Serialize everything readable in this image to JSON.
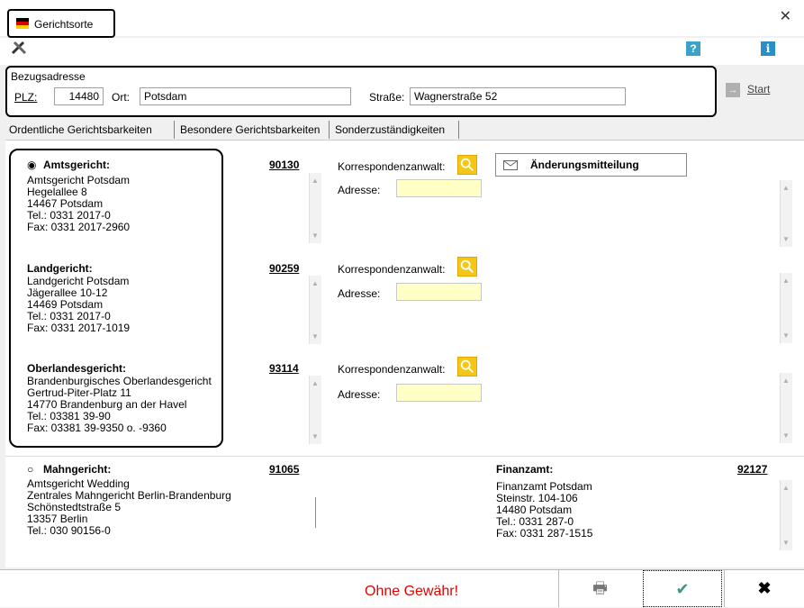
{
  "window": {
    "title": "Gerichtsorte"
  },
  "address": {
    "section_label": "Bezugsadresse",
    "plz_label": "PLZ:",
    "plz_value": "14480",
    "ort_label": "Ort:",
    "ort_value": "Potsdam",
    "strasse_label": "Straße:",
    "strasse_value": "Wagnerstraße 52",
    "start_label": "Start"
  },
  "tabs": [
    {
      "label": "Ordentliche Gerichtsbarkeiten"
    },
    {
      "label": "Besondere Gerichtsbarkeiten"
    },
    {
      "label": "Sonderzuständigkeiten"
    }
  ],
  "courts": {
    "amtsgericht": {
      "title": "Amtsgericht:",
      "code": "90130",
      "lines": [
        "Amtsgericht Potsdam",
        "Hegelallee 8",
        "14467 Potsdam",
        "Tel.: 0331 2017-0",
        "Fax: 0331 2017-2960"
      ]
    },
    "landgericht": {
      "title": "Landgericht:",
      "code": "90259",
      "lines": [
        "Landgericht Potsdam",
        "Jägerallee 10-12",
        "14469 Potsdam",
        "Tel.: 0331 2017-0",
        "Fax: 0331 2017-1019"
      ]
    },
    "oberlandesgericht": {
      "title": "Oberlandesgericht:",
      "code": "93114",
      "lines": [
        "Brandenburgisches Oberlandesgericht",
        "Gertrud-Piter-Platz 11",
        "14770 Brandenburg an der Havel",
        "Tel.: 03381 39-90",
        "Fax: 03381 39-9350 o. -9360"
      ]
    },
    "mahngericht": {
      "title": "Mahngericht:",
      "code": "91065",
      "lines": [
        "Amtsgericht Wedding",
        "Zentrales Mahngericht Berlin-Brandenburg",
        "Schönstedtstraße 5",
        "13357 Berlin",
        "Tel.: 030 90156-0"
      ]
    },
    "finanzamt": {
      "title": "Finanzamt:",
      "code": "92127",
      "lines": [
        "Finanzamt Potsdam",
        "Steinstr. 104-106",
        "14480 Potsdam",
        "Tel.: 0331 287-0",
        "Fax: 0331 287-1515"
      ]
    }
  },
  "korrespondenz_label": "Korrespondenzanwalt:",
  "adresse_label": "Adresse:",
  "aenderung_label": "Änderungsmitteilung",
  "footer": {
    "disclaimer": "Ohne Gewähr!"
  }
}
